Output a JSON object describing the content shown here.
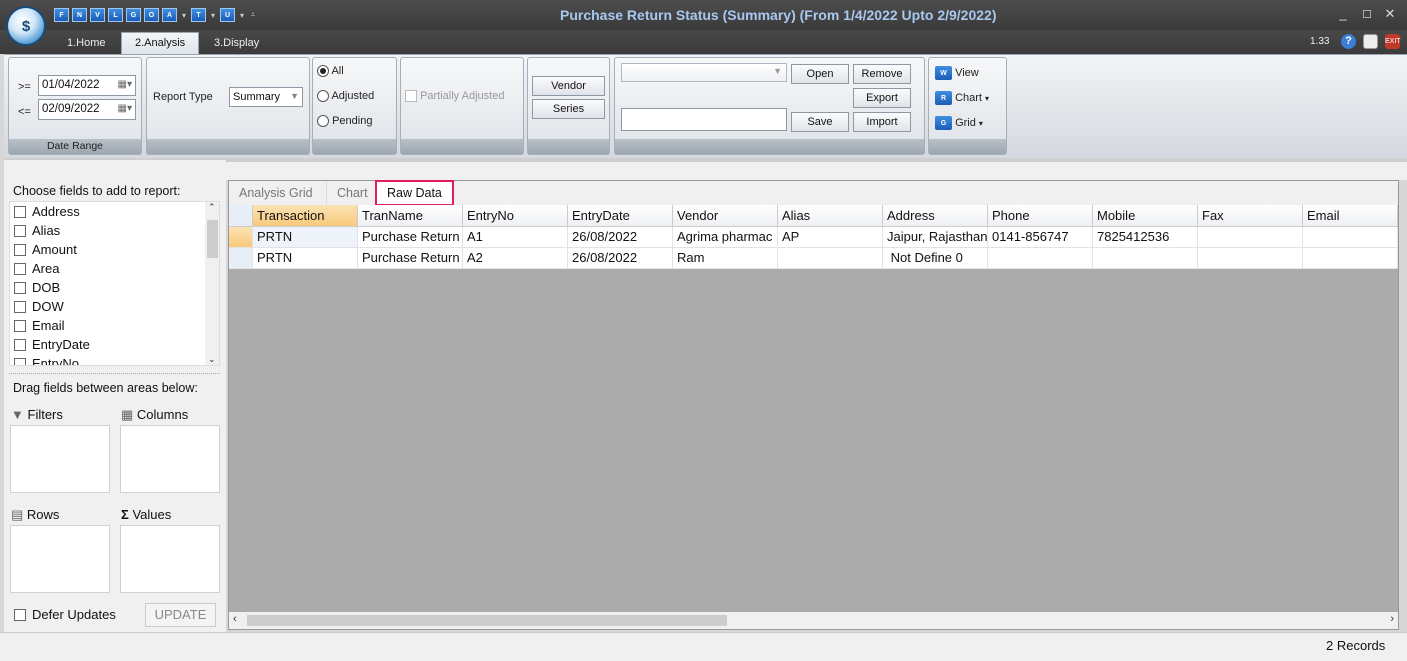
{
  "window": {
    "title": "Purchase Return Status (Summary)  (From 1/4/2022 Upto 2/9/2022)",
    "version": "1.33"
  },
  "qat": [
    "F",
    "N",
    "V",
    "L",
    "G",
    "O",
    "A",
    "T",
    "U"
  ],
  "tabs": [
    "1.Home",
    "2.Analysis",
    "3.Display"
  ],
  "ribbon": {
    "date_from_op": ">=",
    "date_from": "01/04/2022",
    "date_to_op": "<=",
    "date_to": "02/09/2022",
    "date_range_caption": "Date Range",
    "report_type_label": "Report Type",
    "report_type_value": "Summary",
    "radio_all": "All",
    "radio_adjusted": "Adjusted",
    "radio_pending": "Pending",
    "partially_adjusted": "Partially Adjusted",
    "vendor": "Vendor",
    "series": "Series",
    "open": "Open",
    "remove": "Remove",
    "export": "Export",
    "save": "Save",
    "import": "Import",
    "view": "View",
    "chart": "Chart",
    "grid": "Grid"
  },
  "fieldlist": {
    "header": "Choose fields to add to report:",
    "fields": [
      "Address",
      "Alias",
      "Amount",
      "Area",
      "DOB",
      "DOW",
      "Email",
      "EntryDate",
      "EntryNo"
    ],
    "drag_header": "Drag fields between areas below:",
    "filters": "Filters",
    "columns": "Columns",
    "rows": "Rows",
    "values": "Values",
    "defer": "Defer Updates",
    "update": "UPDATE"
  },
  "pivot_tabs": [
    "Analysis Grid",
    "Chart",
    "Raw Data"
  ],
  "grid": {
    "columns": [
      "Transaction",
      "TranName",
      "EntryNo",
      "EntryDate",
      "Vendor",
      "Alias",
      "Address",
      "Phone",
      "Mobile",
      "Fax",
      "Email"
    ],
    "rows": [
      [
        "PRTN",
        "Purchase Return",
        "A1",
        "26/08/2022",
        "Agrima pharmac",
        "AP",
        "Jaipur, Rajasthan",
        "0141-856747",
        "7825412536",
        "",
        ""
      ],
      [
        "PRTN",
        "Purchase Return",
        "A2",
        "26/08/2022",
        "Ram",
        "",
        " Not Define 0",
        "",
        "",
        "",
        ""
      ]
    ]
  },
  "status": {
    "records": "2 Records"
  }
}
